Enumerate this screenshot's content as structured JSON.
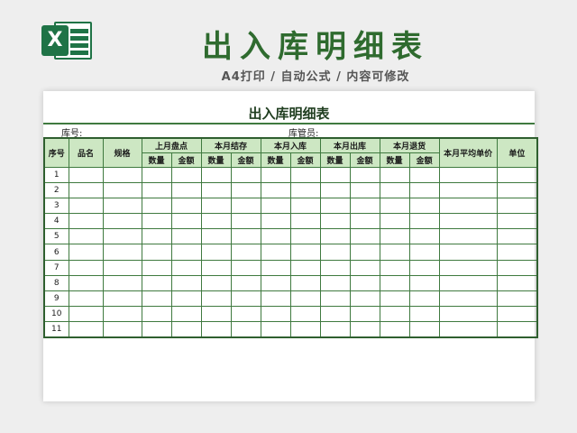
{
  "header": {
    "title": "出入库明细表",
    "subtitle": "A4打印 / 自动公式 / 内容可修改",
    "logo_letter": "X"
  },
  "sheet": {
    "title": "出入库明细表",
    "warehouse_no_label": "库号:",
    "keeper_label": "库管员:"
  },
  "table": {
    "columns": {
      "seq": "序号",
      "name": "品名",
      "spec": "规格",
      "last_month_stock": "上月盘点",
      "month_end_stock": "本月结存",
      "month_in": "本月入库",
      "month_out": "本月出库",
      "month_return": "本月退货",
      "avg_unit_price": "本月平均单价",
      "unit": "单位"
    },
    "sub": {
      "qty": "数量",
      "amount": "金额"
    },
    "rows": [
      "1",
      "2",
      "3",
      "4",
      "5",
      "6",
      "7",
      "8",
      "9",
      "10",
      "11"
    ]
  },
  "colors": {
    "accent": "#2f6b2f",
    "excel_green": "#1f7346",
    "header_fill": "#cde7c3",
    "grid_line": "#3f7a3f"
  }
}
